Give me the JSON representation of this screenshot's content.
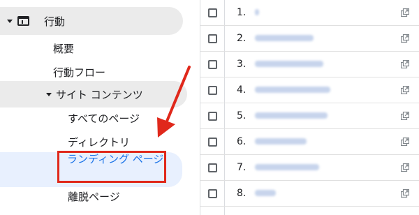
{
  "sidebar": {
    "behavior": "行動",
    "overview": "概要",
    "behavior_flow": "行動フロー",
    "site_content": "サイト コンテンツ",
    "all_pages": "すべてのページ",
    "directory": "ディレクトリ",
    "landing_pages": "ランディング ページ",
    "exit_pages": "離脱ページ"
  },
  "colors": {
    "highlight_box": "#e0281b",
    "annotation_arrow": "#e0281b",
    "active_link": "#1a73e8",
    "active_bg": "#e8f0fe"
  },
  "table": {
    "rows": [
      {
        "num": "1."
      },
      {
        "num": "2."
      },
      {
        "num": "3."
      },
      {
        "num": "4."
      },
      {
        "num": "5."
      },
      {
        "num": "6."
      },
      {
        "num": "7."
      },
      {
        "num": "8."
      }
    ]
  }
}
